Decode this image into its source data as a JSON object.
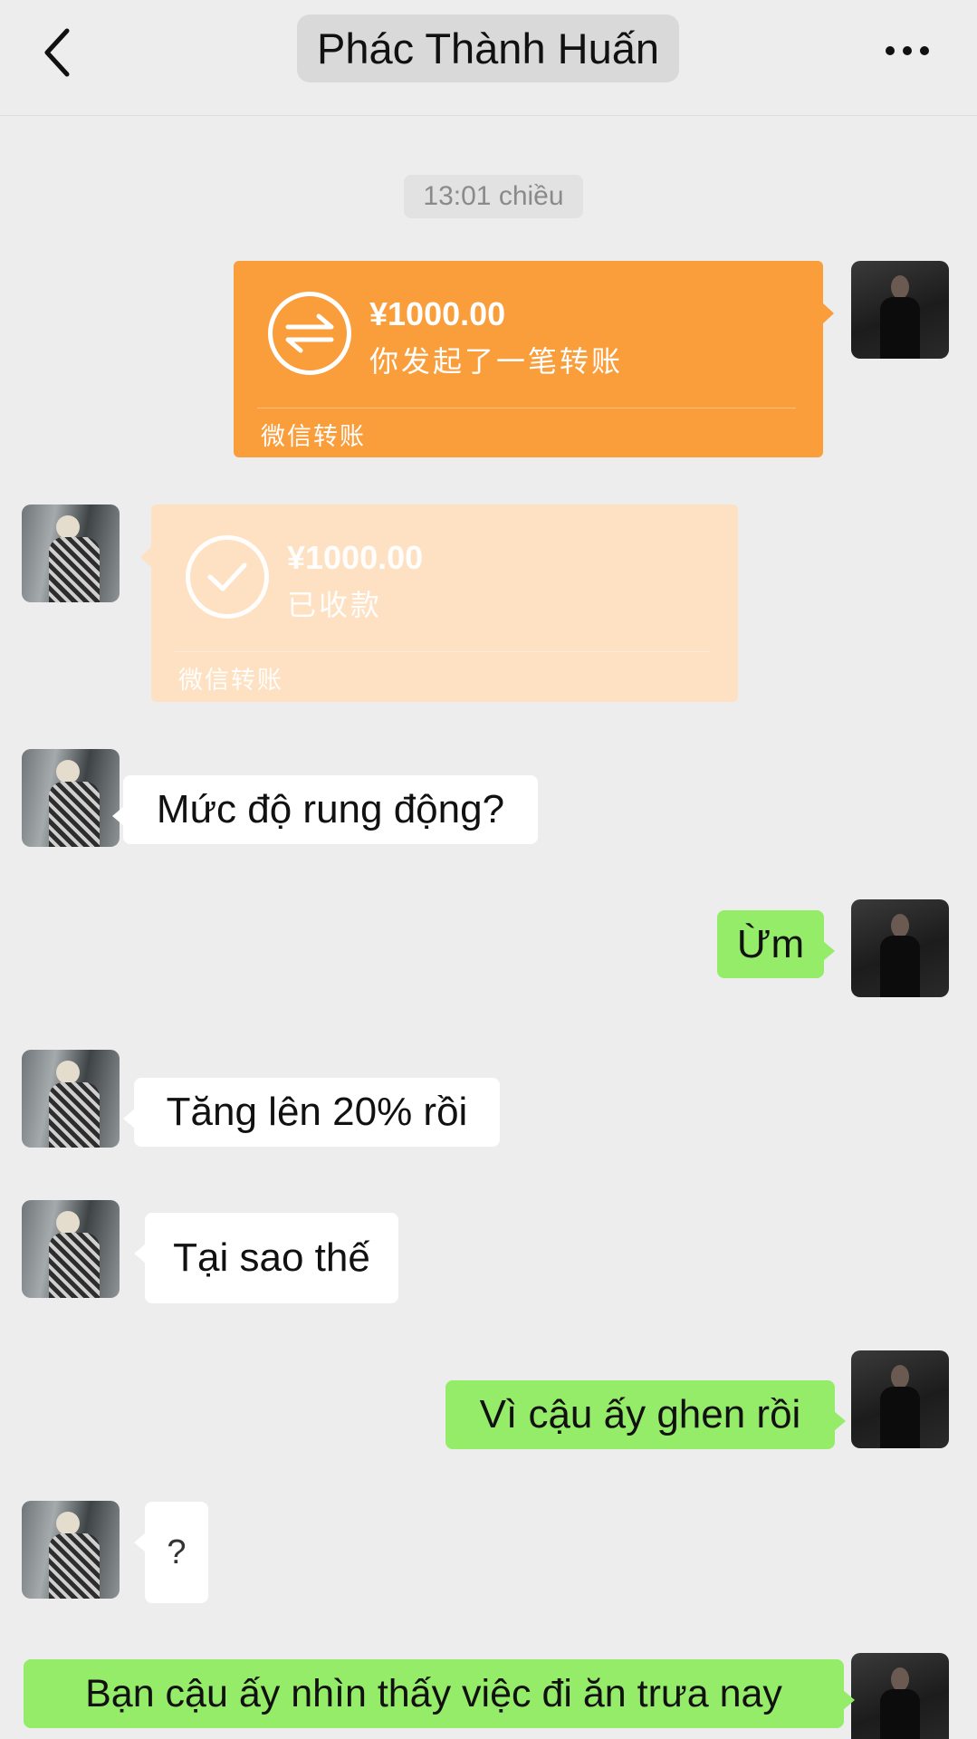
{
  "header": {
    "title": "Phác Thành Huấn",
    "back_icon": "chevron-left-icon",
    "more_icon": "more-dots-icon"
  },
  "timestamp": "13:01 chiều",
  "transfers": {
    "sent": {
      "amount": "¥1000.00",
      "description": "你发起了一笔转账",
      "footer": "微信转账",
      "icon": "transfer-arrows-icon"
    },
    "received": {
      "amount": "¥1000.00",
      "description": "已收款",
      "footer": "微信转账",
      "icon": "check-circle-icon"
    }
  },
  "messages": [
    {
      "from": "other",
      "text": "Mức độ rung động?"
    },
    {
      "from": "me",
      "text": "Ừm"
    },
    {
      "from": "other",
      "text": "Tăng lên 20% rồi"
    },
    {
      "from": "other",
      "text": "Tại sao thế"
    },
    {
      "from": "me",
      "text": "Vì cậu ấy ghen rồi"
    },
    {
      "from": "other",
      "text": "?"
    },
    {
      "from": "me",
      "text": "Bạn cậu ấy nhìn thấy việc đi ăn trưa nay"
    }
  ],
  "colors": {
    "background": "#ededed",
    "sent_bubble": "#95ec69",
    "received_bubble": "#ffffff",
    "transfer_sent": "#fa9d3b",
    "transfer_received": "#fde1c2"
  }
}
